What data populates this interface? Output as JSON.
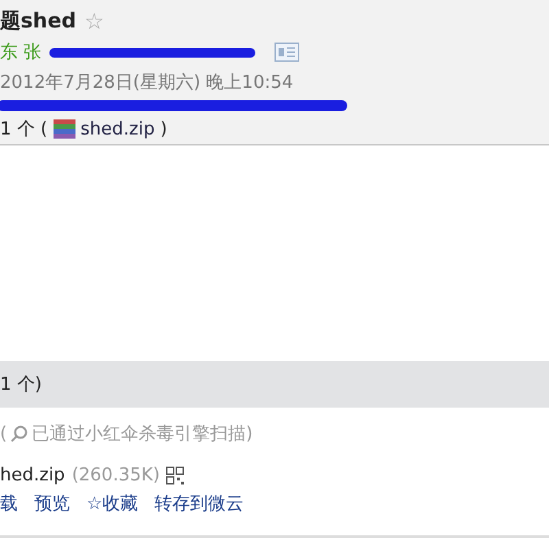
{
  "header": {
    "subject": "题shed",
    "star": "☆",
    "sender": "东 张",
    "date": "2012年7月28日(星期六) 晚上10:54",
    "attachment_summary": {
      "prefix": "1 个 (",
      "file": "shed.zip",
      "suffix": ")"
    }
  },
  "attachments_bar": {
    "label": "1 个)"
  },
  "attachment": {
    "scan_open": "(",
    "scan_note": "已通过小红伞杀毒引擎扫描)",
    "name": "hed.zip",
    "size": "(260.35K)",
    "actions": [
      "载",
      "预览",
      "☆收藏",
      "转存到微云"
    ]
  }
}
